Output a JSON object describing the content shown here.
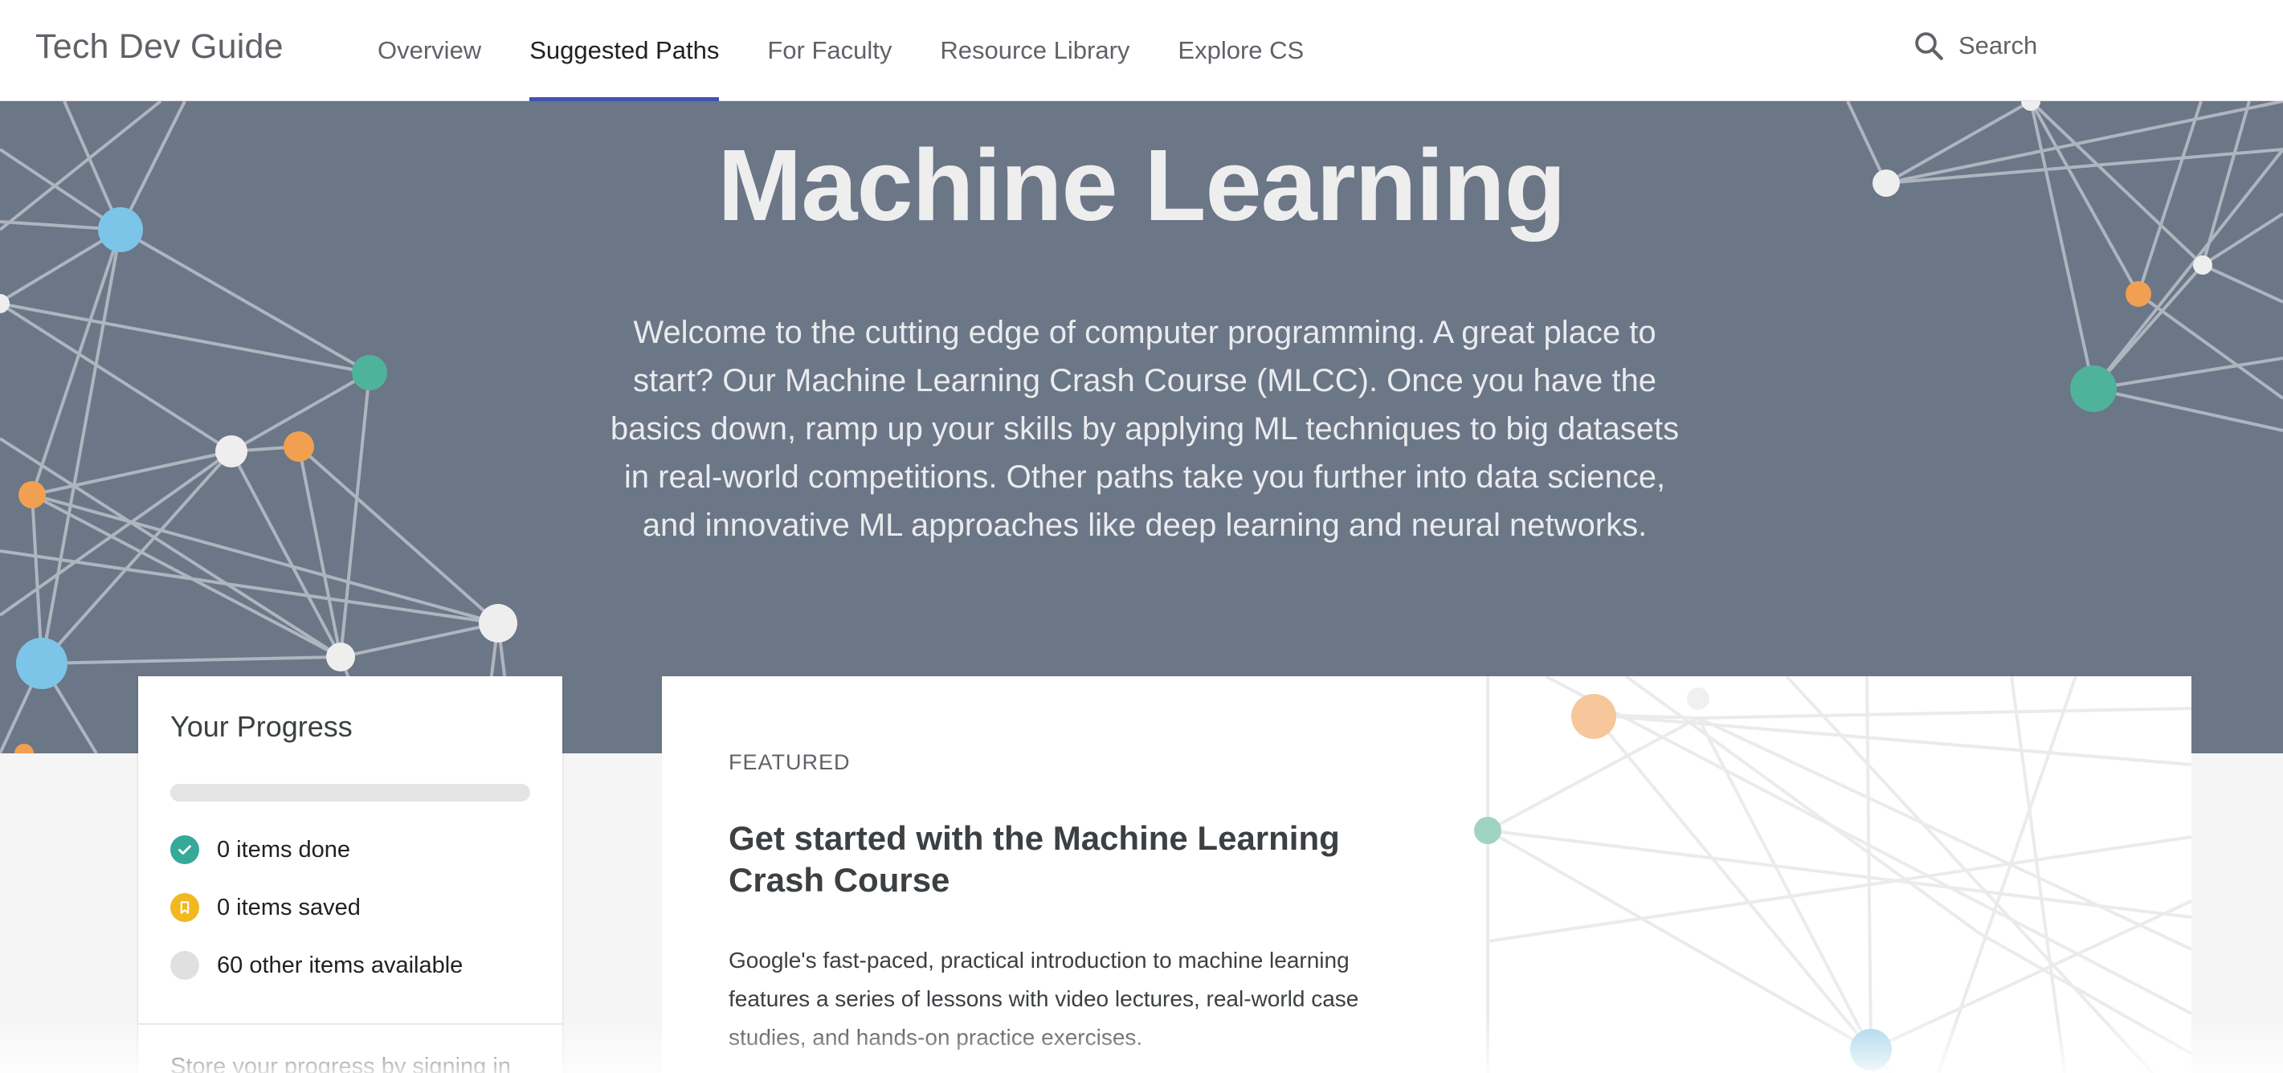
{
  "header": {
    "brand": "Tech Dev Guide",
    "nav": [
      {
        "label": "Overview",
        "active": false
      },
      {
        "label": "Suggested Paths",
        "active": true
      },
      {
        "label": "For Faculty",
        "active": false
      },
      {
        "label": "Resource Library",
        "active": false
      },
      {
        "label": "Explore CS",
        "active": false
      }
    ],
    "search_label": "Search"
  },
  "hero": {
    "title": "Machine Learning",
    "description": "Welcome to the cutting edge of computer programming. A great place to start? Our Machine Learning Crash Course (MLCC). Once you have the basics down, ramp up your skills by applying ML techniques to big datasets in real-world competitions. Other paths take you further into data science, and innovative ML approaches like deep learning and neural networks."
  },
  "progress": {
    "title": "Your Progress",
    "progress_fraction": 0,
    "done": "0 items done",
    "saved": "0 items saved",
    "available": "60 other items available",
    "store_text": "Store your progress by signing in"
  },
  "featured": {
    "label": "FEATURED",
    "title": "Get started with the Machine Learning Crash Course",
    "description": "Google's fast-paced, practical introduction to machine learning features a series of lessons with video lectures, real-world case studies, and hands-on practice exercises."
  },
  "colors": {
    "accent": "#3f51b5",
    "hero_bg": "#6b7686",
    "node_blue": "#7cc4e8",
    "node_teal": "#4fb39c",
    "node_orange": "#f0a050",
    "done_green": "#35a99a",
    "saved_yellow": "#f2b820",
    "available_gray": "#e0e0e0"
  }
}
